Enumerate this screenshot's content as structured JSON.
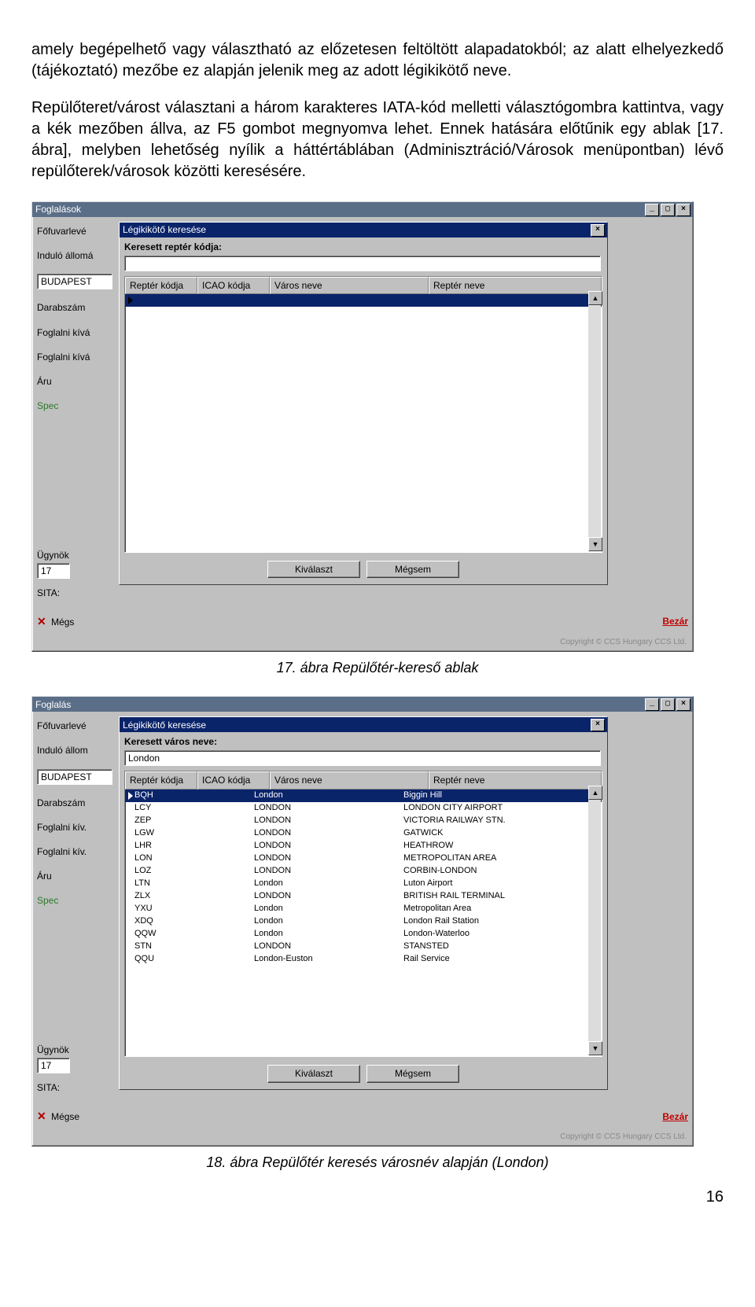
{
  "text": {
    "p1": "amely begépelhető vagy választható az előzetesen feltöltött alapadatokból; az alatt elhelyezkedő (tájékoztató) mezőbe ez alapján jelenik meg az adott légikikötő neve.",
    "p2": "Repülőteret/várost választani a három karakteres IATA-kód melletti választógombra kattintva, vagy a kék mezőben állva, az F5 gombot megnyomva lehet. Ennek hatására előtűnik egy ablak [17. ábra], melyben lehetőség nyílik a háttértáblában (Adminisztráció/Városok menüpontban) lévő repülőterek/városok közötti keresésére."
  },
  "captions": {
    "fig17": "17. ábra Repülőtér-kereső ablak",
    "fig18": "18. ábra Repülőtér keresés városnév alapján (London)"
  },
  "winLabels": {
    "foglalasok": "Foglalások",
    "foglalas": "Foglalás",
    "fofuvarleve": "Főfuvarlevé",
    "induloAlloma": "Induló állomá",
    "induloAllom": "Induló állom",
    "budapest": "BUDAPEST",
    "darabszam": "Darabszám",
    "foglalniKiva": "Foglalni kívá",
    "foglalniKiv": "Foglalni kív.",
    "aru": "Áru",
    "spec": "Spec",
    "ugynok": "Ügynök",
    "ugynokVal": "17",
    "sita": "SITA:",
    "megs": "Mégs",
    "megse": "Mégse",
    "bezar": "Bezár",
    "copyright": "Copyright © CCS Hungary CCS Ltd."
  },
  "popup1": {
    "title": "Légikikötő keresése",
    "searchLabel": "Keresett reptér kódja:",
    "searchValue": "",
    "headers": [
      "Reptér kódja",
      "ICAO kódja",
      "Város neve",
      "Reptér neve"
    ],
    "btnOk": "Kiválaszt",
    "btnCancel": "Mégsem"
  },
  "popup2": {
    "title": "Légikikötő keresése",
    "searchLabel": "Keresett város neve:",
    "searchValue": "London",
    "headers": [
      "Reptér kódja",
      "ICAO kódja",
      "Város neve",
      "Reptér neve"
    ],
    "rows": [
      [
        "BQH",
        "",
        "London",
        "Biggin Hill"
      ],
      [
        "LCY",
        "",
        "LONDON",
        "LONDON CITY AIRPORT"
      ],
      [
        "ZEP",
        "",
        "LONDON",
        "VICTORIA RAILWAY STN."
      ],
      [
        "LGW",
        "",
        "LONDON",
        "GATWICK"
      ],
      [
        "LHR",
        "",
        "LONDON",
        "HEATHROW"
      ],
      [
        "LON",
        "",
        "LONDON",
        "METROPOLITAN AREA"
      ],
      [
        "LOZ",
        "",
        "LONDON",
        "CORBIN-LONDON"
      ],
      [
        "LTN",
        "",
        "London",
        "Luton Airport"
      ],
      [
        "ZLX",
        "",
        "LONDON",
        "BRITISH RAIL TERMINAL"
      ],
      [
        "YXU",
        "",
        "London",
        "Metropolitan Area"
      ],
      [
        "XDQ",
        "",
        "London",
        "London Rail Station"
      ],
      [
        "QQW",
        "",
        "London",
        "London-Waterloo"
      ],
      [
        "STN",
        "",
        "LONDON",
        "STANSTED"
      ],
      [
        "QQU",
        "",
        "London-Euston",
        "Rail Service"
      ]
    ],
    "btnOk": "Kiválaszt",
    "btnCancel": "Mégsem"
  },
  "pageNumber": "16"
}
